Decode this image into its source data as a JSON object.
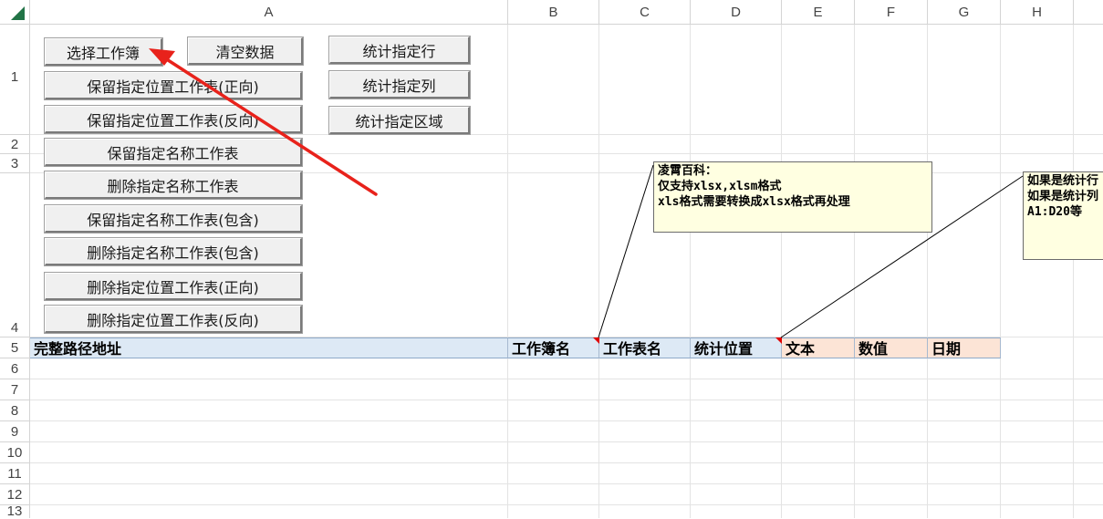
{
  "columns": [
    "A",
    "B",
    "C",
    "D",
    "E",
    "F",
    "G",
    "H"
  ],
  "rows": [
    "1",
    "2",
    "3",
    "4",
    "5",
    "6",
    "7",
    "8",
    "9",
    "10",
    "11",
    "12",
    "13"
  ],
  "buttons": {
    "select_workbook": "选择工作簿",
    "clear_data": "清空数据",
    "keep_sheets_by_position_forward": "保留指定位置工作表(正向)",
    "keep_sheets_by_position_reverse": "保留指定位置工作表(反向)",
    "keep_sheets_by_name": "保留指定名称工作表",
    "delete_sheets_by_name": "删除指定名称工作表",
    "keep_sheets_by_name_contains": "保留指定名称工作表(包含)",
    "delete_sheets_by_name_contains": "删除指定名称工作表(包含)",
    "delete_sheets_by_position_forward": "删除指定位置工作表(正向)",
    "delete_sheets_by_position_reverse": "删除指定位置工作表(反向)",
    "count_specified_rows": "统计指定行",
    "count_specified_columns": "统计指定列",
    "count_specified_range": "统计指定区域"
  },
  "header_row": {
    "full_path": "完整路径地址",
    "workbook_name": "工作簿名",
    "worksheet_name": "工作表名",
    "stat_position": "统计位置",
    "text": "文本",
    "number": "数值",
    "date": "日期"
  },
  "comments": {
    "format_note": "凌霄百科：\n仅支持xlsx,xlsm格式\nxls格式需要转换成xlsx格式再处理",
    "position_note": "如果是统计行\n如果是统计列\nA1:D20等"
  },
  "colors": {
    "header_blue": "#dde9f5",
    "header_peach": "#fce4d6",
    "comment_bg": "#ffffe1",
    "arrow_red": "#e8221b",
    "corner_green": "#217346"
  }
}
